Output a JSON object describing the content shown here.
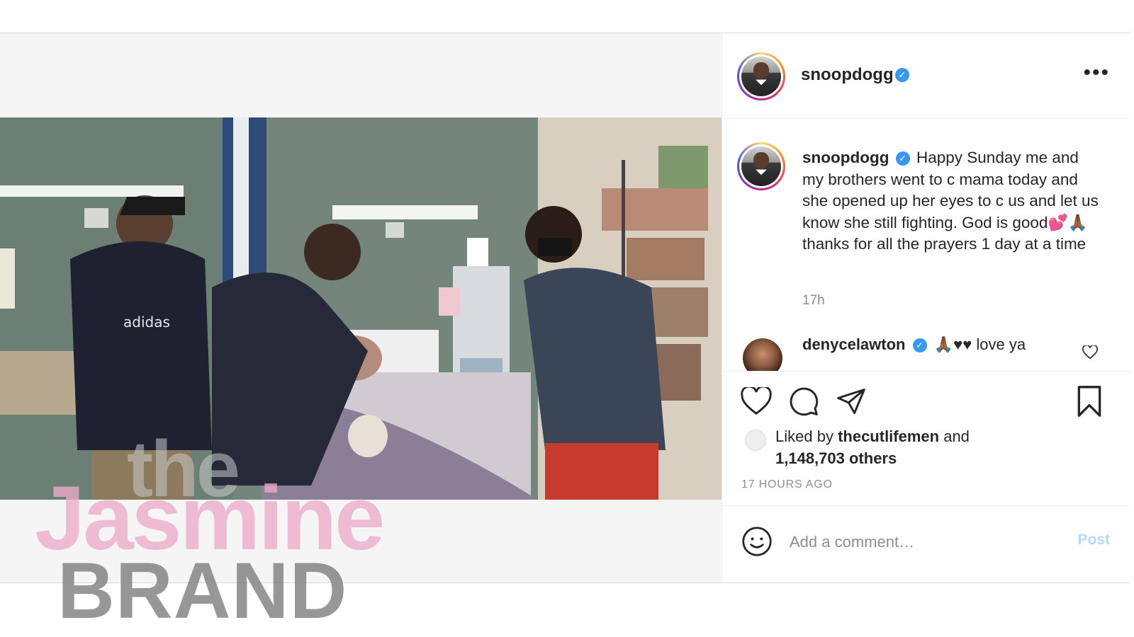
{
  "post": {
    "author": {
      "username": "snoopdogg",
      "verified_icon": "verified-badge-icon"
    },
    "caption": {
      "username": "snoopdogg",
      "text": "Happy Sunday me and my brothers went to c mama today and she opened up her eyes to c us and let us know she still fighting. God is good💕🙏🏾thanks for all the prayers 1 day at a time",
      "time": "17h"
    },
    "comment": {
      "username": "denycelawton",
      "text": "🙏🏾♥♥ love ya"
    },
    "likes": {
      "prefix": "Liked by ",
      "user": "thecutlifemen",
      "suffix": " and",
      "count": "1,148,703 others"
    },
    "timestamp": "17 hours ago",
    "add_comment": {
      "placeholder": "Add a comment…",
      "post_label": "Post"
    }
  },
  "watermark": {
    "the": "the",
    "jasmine": "Jasmine",
    "brand": "BRAND"
  },
  "icons": {
    "more": "more-options-icon",
    "like": "heart-icon",
    "comment": "comment-icon",
    "share": "share-icon",
    "save": "bookmark-icon",
    "emoji": "emoji-icon"
  },
  "colors": {
    "verified": "#3897f0",
    "post_button": "#b3dbff",
    "secondary_text": "#8e8e8e"
  }
}
